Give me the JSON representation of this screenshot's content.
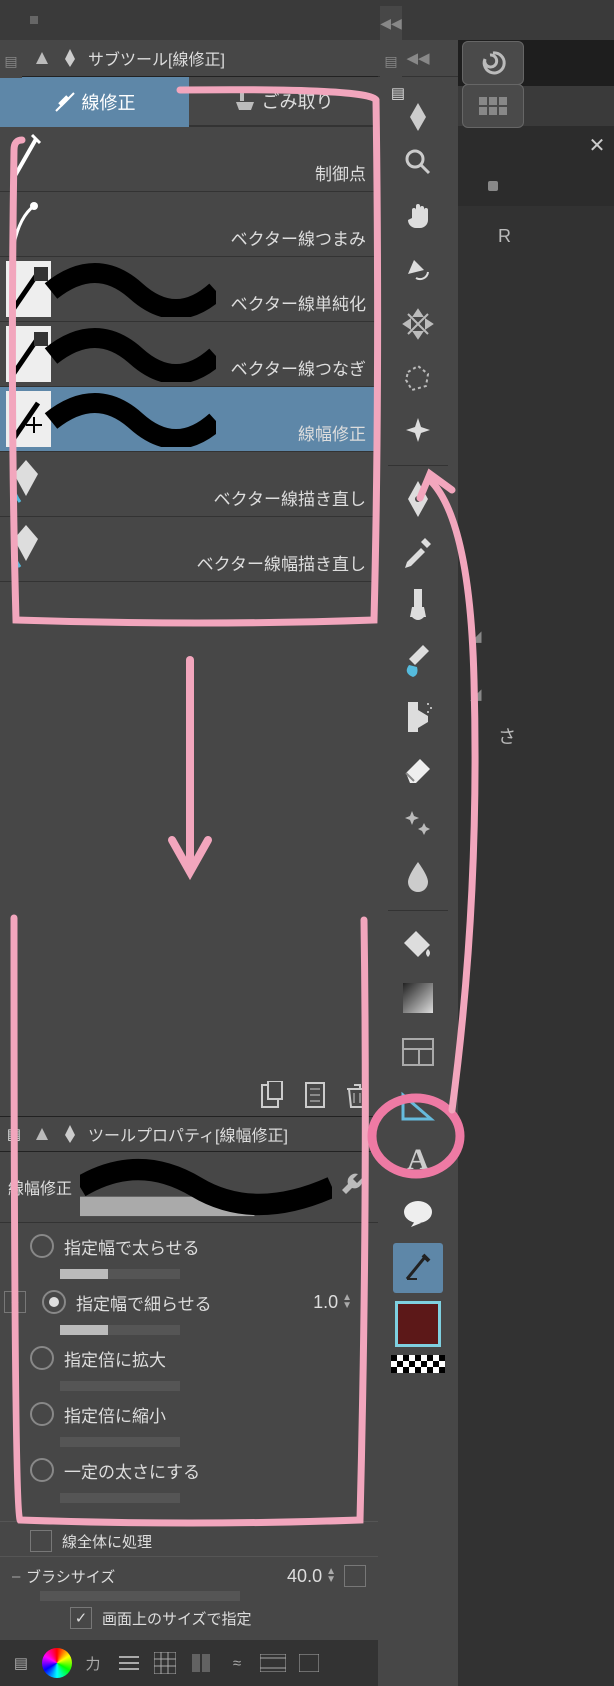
{
  "subtool_panel": {
    "title": "サブツール[線修正]",
    "tabs": [
      {
        "label": "線修正",
        "key": "correct",
        "active": true
      },
      {
        "label": "ごみ取り",
        "key": "dust",
        "active": false
      }
    ],
    "items": [
      {
        "label": "制御点",
        "selected": false,
        "thumb": "none"
      },
      {
        "label": "ベクター線つまみ",
        "selected": false,
        "thumb": "pinch"
      },
      {
        "label": "ベクター線単純化",
        "selected": false,
        "thumb": "stroke"
      },
      {
        "label": "ベクター線つなぎ",
        "selected": false,
        "thumb": "stroke"
      },
      {
        "label": "線幅修正",
        "selected": true,
        "thumb": "stroke"
      },
      {
        "label": "ベクター線描き直し",
        "selected": false,
        "thumb": "redraw"
      },
      {
        "label": "ベクター線幅描き直し",
        "selected": false,
        "thumb": "redraw"
      }
    ]
  },
  "tool_property": {
    "title": "ツールプロパティ[線幅修正]",
    "name": "線幅修正",
    "options": [
      {
        "label": "指定幅で太らせる",
        "selected": false
      },
      {
        "label": "指定幅で細らせる",
        "selected": true
      },
      {
        "label": "指定倍に拡大",
        "selected": false
      },
      {
        "label": "指定倍に縮小",
        "selected": false
      },
      {
        "label": "一定の太さにする",
        "selected": false
      }
    ],
    "amount_value": "1.0",
    "whole_line": {
      "label": "線全体に処理",
      "checked": false
    },
    "brush_size": {
      "label": "ブラシサイズ",
      "value": "40.0"
    },
    "on_screen": {
      "label": "画面上のサイズで指定",
      "checked": true
    }
  },
  "toolbar": {
    "groups": [
      [
        "magnifier",
        "hand",
        "rotate",
        "move-arrows",
        "lasso-poly",
        "sparkle"
      ],
      [
        "pen",
        "dropper",
        "brush-thick",
        "brush-paint",
        "airbrush",
        "eraser",
        "sparkles",
        "blend"
      ],
      [
        "fill",
        "gradient",
        "frame",
        "ruler-triangle",
        "text",
        "balloon",
        "line-correct"
      ]
    ],
    "selected": "line-correct",
    "swatch_color": "#5c1818"
  },
  "right": {
    "label_r": "R",
    "label_sa": "さ"
  },
  "nav": {
    "label": "力"
  }
}
